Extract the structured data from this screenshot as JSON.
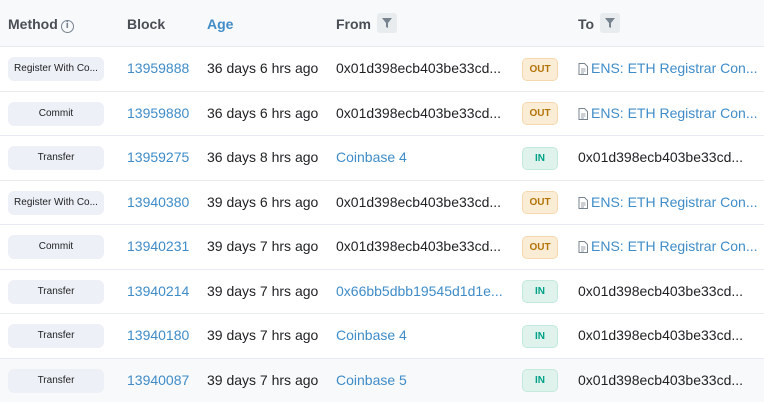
{
  "header": {
    "method": "Method",
    "block": "Block",
    "age": "Age",
    "from": "From",
    "to": "To"
  },
  "rows": [
    {
      "method": "Register With Co...",
      "block": "13959888",
      "age": "36 days 6 hrs ago",
      "from": "0x01d398ecb403be33cd...",
      "from_link": false,
      "direction": "OUT",
      "to": "ENS: ETH Registrar Con...",
      "to_contract": true
    },
    {
      "method": "Commit",
      "block": "13959880",
      "age": "36 days 6 hrs ago",
      "from": "0x01d398ecb403be33cd...",
      "from_link": false,
      "direction": "OUT",
      "to": "ENS: ETH Registrar Con...",
      "to_contract": true
    },
    {
      "method": "Transfer",
      "block": "13959275",
      "age": "36 days 8 hrs ago",
      "from": "Coinbase 4",
      "from_link": true,
      "direction": "IN",
      "to": "0x01d398ecb403be33cd...",
      "to_contract": false
    },
    {
      "method": "Register With Co...",
      "block": "13940380",
      "age": "39 days 6 hrs ago",
      "from": "0x01d398ecb403be33cd...",
      "from_link": false,
      "direction": "OUT",
      "to": "ENS: ETH Registrar Con...",
      "to_contract": true
    },
    {
      "method": "Commit",
      "block": "13940231",
      "age": "39 days 7 hrs ago",
      "from": "0x01d398ecb403be33cd...",
      "from_link": false,
      "direction": "OUT",
      "to": "ENS: ETH Registrar Con...",
      "to_contract": true
    },
    {
      "method": "Transfer",
      "block": "13940214",
      "age": "39 days 7 hrs ago",
      "from": "0x66bb5dbb19545d1d1e...",
      "from_link": true,
      "direction": "IN",
      "to": "0x01d398ecb403be33cd...",
      "to_contract": false
    },
    {
      "method": "Transfer",
      "block": "13940180",
      "age": "39 days 7 hrs ago",
      "from": "Coinbase 4",
      "from_link": true,
      "direction": "IN",
      "to": "0x01d398ecb403be33cd...",
      "to_contract": false
    },
    {
      "method": "Transfer",
      "block": "13940087",
      "age": "39 days 7 hrs ago",
      "from": "Coinbase 5",
      "from_link": true,
      "direction": "IN",
      "to": "0x01d398ecb403be33cd...",
      "to_contract": false
    }
  ],
  "colors": {
    "link": "#3f8cc8",
    "out_badge_bg": "#fbecd6",
    "out_badge_text": "#b37407",
    "in_badge_bg": "#dff3ec",
    "in_badge_text": "#00a186",
    "header_bg": "#f8f9fa"
  },
  "icons": {
    "method_info": "info-circle-icon",
    "filter": "filter-icon",
    "contract": "document-icon"
  }
}
